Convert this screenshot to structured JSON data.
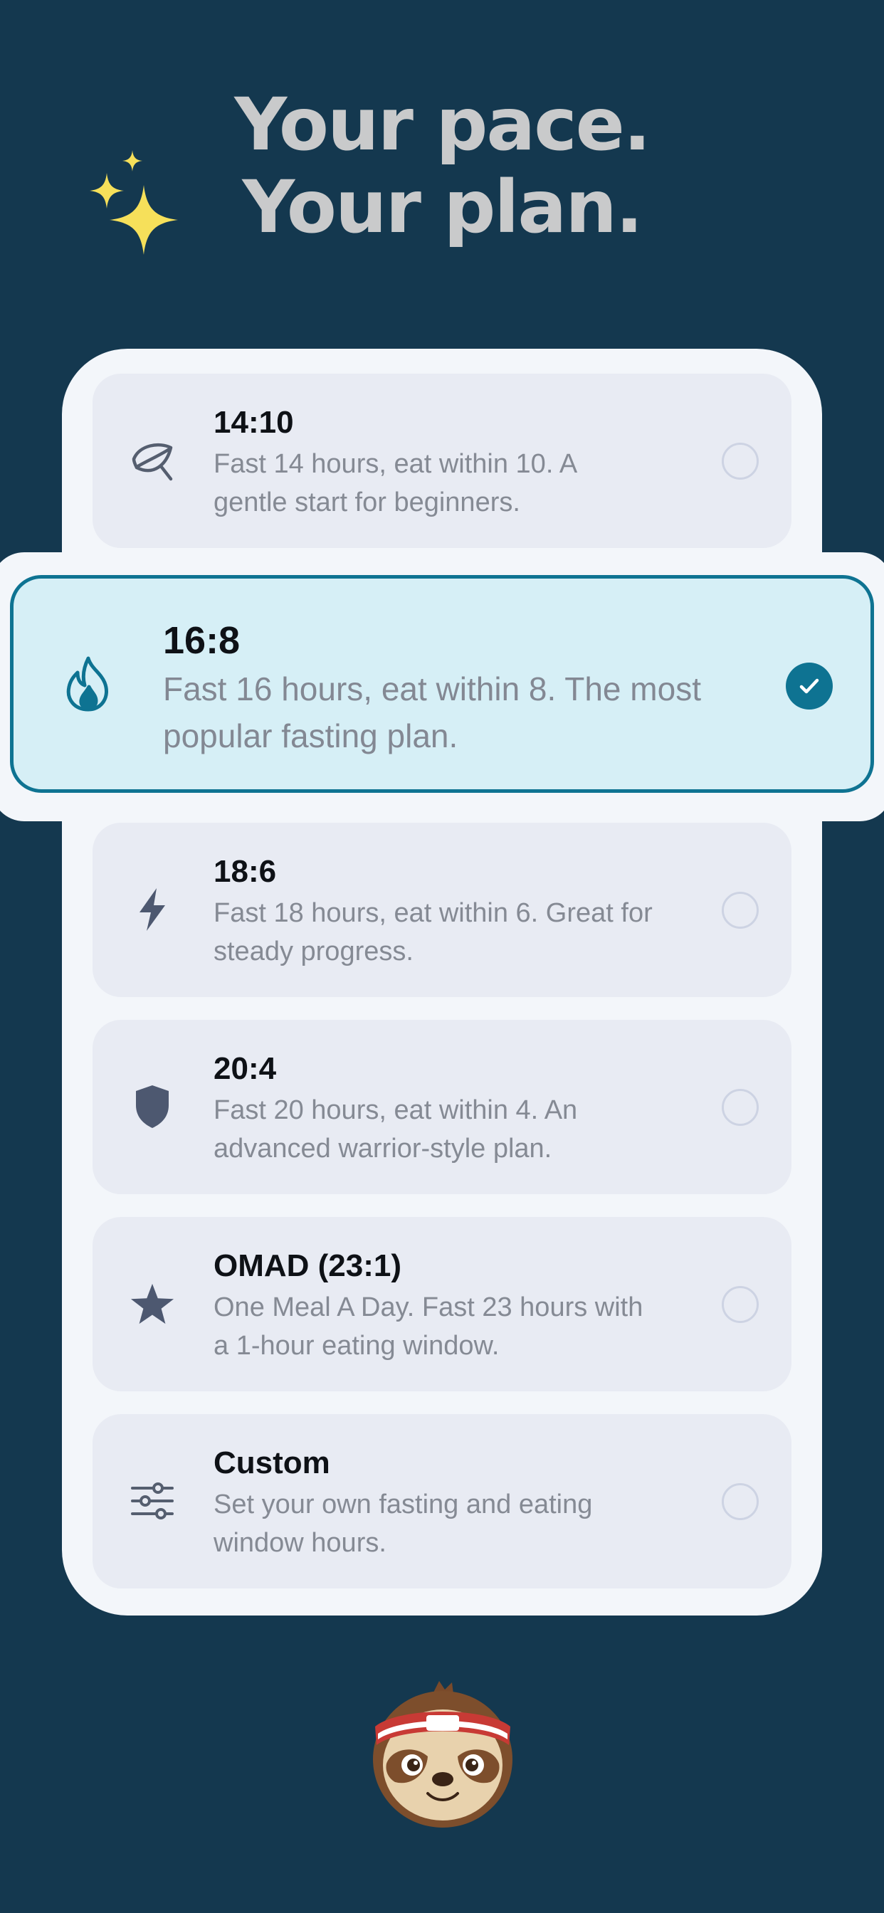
{
  "headline": {
    "line1": "Your pace.",
    "line2": "Your plan."
  },
  "plans": [
    {
      "id": "14-10",
      "title": "14:10",
      "description": "Fast 14 hours, eat within 10. A gentle start for beginners.",
      "icon": "leaf-icon",
      "selected": false
    },
    {
      "id": "16-8",
      "title": "16:8",
      "description": "Fast 16 hours, eat within 8. The most popular fasting plan.",
      "icon": "flame-icon",
      "selected": true
    },
    {
      "id": "18-6",
      "title": "18:6",
      "description": "Fast 18 hours, eat within 6. Great for steady progress.",
      "icon": "lightning-icon",
      "selected": false
    },
    {
      "id": "20-4",
      "title": "20:4",
      "description": "Fast 20 hours, eat within 4. An advanced warrior-style plan.",
      "icon": "shield-icon",
      "selected": false
    },
    {
      "id": "omad",
      "title": "OMAD (23:1)",
      "description": "One Meal A Day. Fast 23 hours with a 1-hour eating window.",
      "icon": "star-icon",
      "selected": false
    },
    {
      "id": "custom",
      "title": "Custom",
      "description": "Set your own fasting and eating window hours.",
      "icon": "sliders-icon",
      "selected": false
    }
  ],
  "colors": {
    "background": "#14384f",
    "accent": "#0e7392",
    "selected_fill": "#d6eff6",
    "sparkle": "#f6e05a"
  }
}
